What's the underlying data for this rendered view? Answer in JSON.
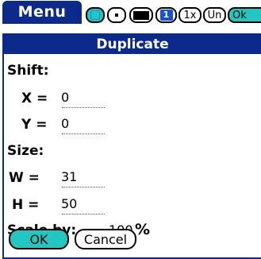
{
  "menu": {
    "label": "Menu"
  },
  "toolbar": {
    "one_label": "1",
    "x_label": "1x",
    "undo_label": "Un",
    "ok_label": "Ok"
  },
  "dialog": {
    "title": "Duplicate",
    "shift": {
      "heading": "Shift:",
      "x_label": "X =",
      "x_value": "0",
      "y_label": "Y =",
      "y_value": "0"
    },
    "size": {
      "heading": "Size:",
      "w_label": "W =",
      "w_value": "31",
      "h_label": "H =",
      "h_value": "50"
    },
    "scale": {
      "label": "Scale by:",
      "value": "100",
      "unit": "%"
    },
    "ok_label": "OK",
    "cancel_label": "Cancel"
  },
  "colors": {
    "title_bar": "#0b2a8c",
    "accent_teal": "#22c7c2",
    "accent_blue": "#1a4fd8"
  },
  "icons": [
    "selection-icon",
    "dot-brush-icon",
    "fill-black-icon"
  ]
}
